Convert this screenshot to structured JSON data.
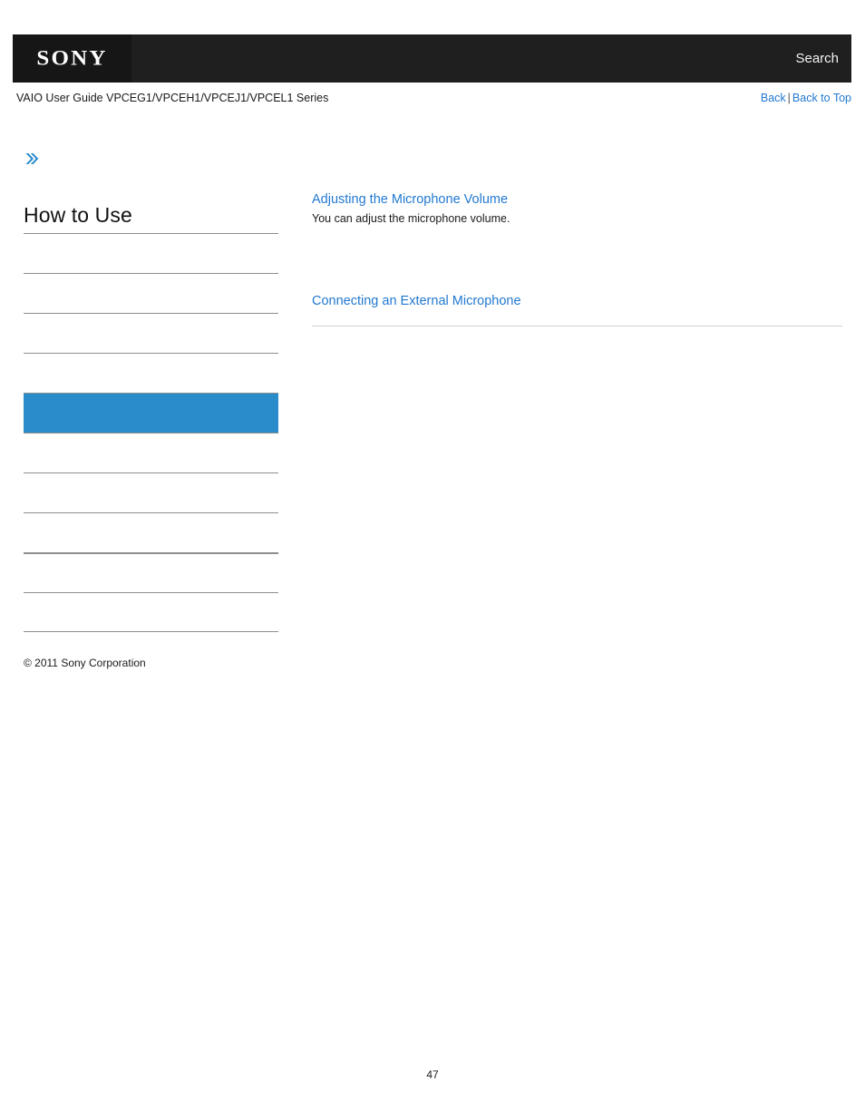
{
  "header": {
    "logo": "SONY",
    "search_label": "Search"
  },
  "subheader": {
    "guide_title": "VAIO User Guide VPCEG1/VPCEH1/VPCEJ1/VPCEL1 Series",
    "back_label": "Back",
    "separator": "|",
    "back_to_top_label": "Back to Top"
  },
  "sidebar": {
    "expander_icon": "double-chevron-right-icon",
    "heading": "How to Use",
    "items": [
      {
        "label": "",
        "active": false,
        "thick": false
      },
      {
        "label": "",
        "active": false,
        "thick": false
      },
      {
        "label": "",
        "active": false,
        "thick": false
      },
      {
        "label": "",
        "active": false,
        "thick": false
      },
      {
        "label": "",
        "active": true,
        "thick": false
      },
      {
        "label": "",
        "active": false,
        "thick": false
      },
      {
        "label": "",
        "active": false,
        "thick": false
      },
      {
        "label": "",
        "active": false,
        "thick": false
      },
      {
        "label": "",
        "active": false,
        "thick": true
      },
      {
        "label": "",
        "active": false,
        "thick": false
      }
    ],
    "copyright": "© 2011 Sony Corporation"
  },
  "content": {
    "entries": [
      {
        "title": "Adjusting the Microphone Volume",
        "description": "You can adjust the microphone volume."
      },
      {
        "title": "Connecting an External Microphone",
        "description": ""
      }
    ]
  },
  "footer": {
    "page_number": "47"
  },
  "colors": {
    "header_bg": "#1f1f1f",
    "logo_bg": "#161616",
    "link_blue": "#2279d0",
    "highlight_blue": "#2b8ccc",
    "rule_gray": "#8e8e8e",
    "content_rule_gray": "#cfcfcf"
  }
}
